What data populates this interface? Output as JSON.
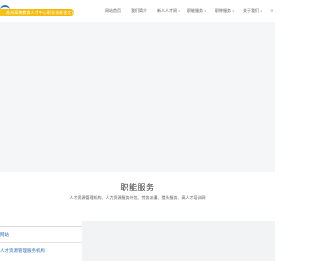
{
  "header": {
    "logo_text": "苏州高博教育人才中心职业技能鉴定站",
    "nav": [
      {
        "label": "网站首页",
        "has_caret": false
      },
      {
        "label": "我们简介",
        "has_caret": false
      },
      {
        "label": "新人人才网",
        "has_caret": true
      },
      {
        "label": "职能服务",
        "has_caret": true
      },
      {
        "label": "职称服务",
        "has_caret": true
      },
      {
        "label": "关于我们",
        "has_caret": true
      },
      {
        "label": "ㅇ",
        "has_caret": false
      }
    ],
    "caret": "∨"
  },
  "section": {
    "title": "职能服务",
    "subtitle": "人才资源管理机构、人力资源服务外包、劳务派遣、猎头服务、高人才培训网"
  },
  "side_list": [
    {
      "label": "网站"
    },
    {
      "label": "人才资源管理服务机构"
    }
  ],
  "colors": {
    "accent_gold": "#f4c21a",
    "link_blue": "#2e6cb5",
    "hero_bg": "#f5f6f7",
    "panel_bg": "#f2f3f5"
  }
}
